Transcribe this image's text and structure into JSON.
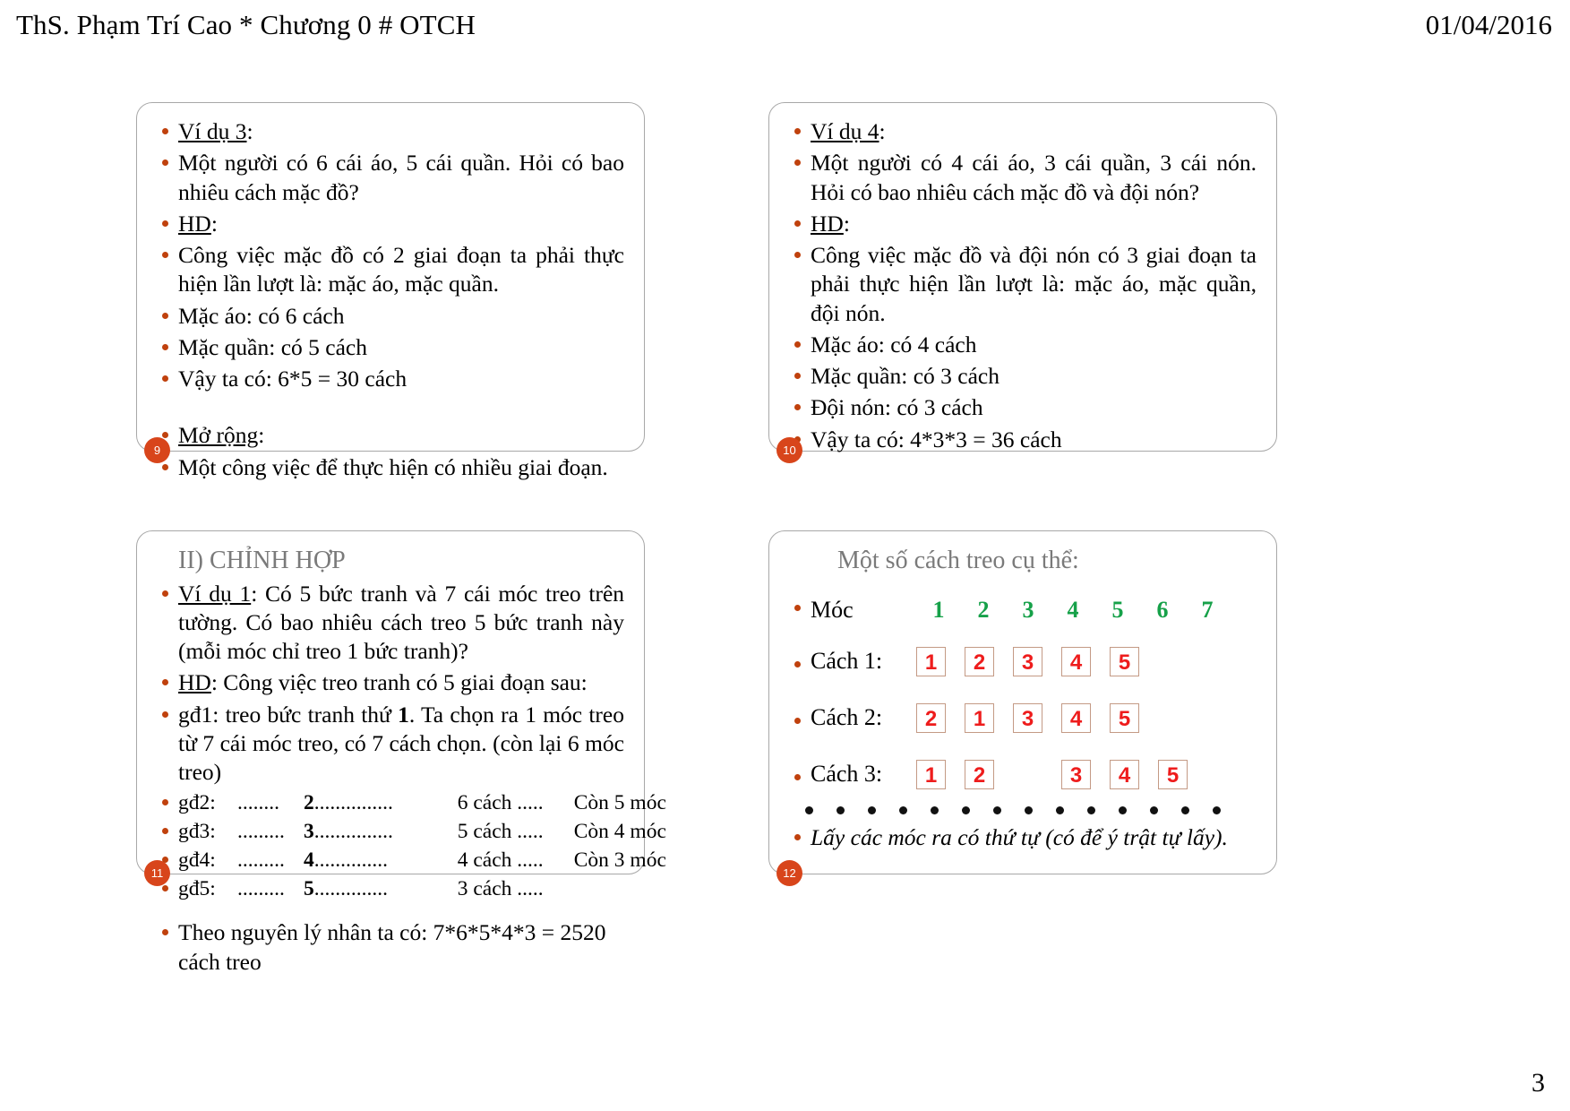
{
  "header": {
    "left": "ThS. Phạm Trí Cao * Chương 0 # OTCH",
    "date": "01/04/2016",
    "page_number": "3"
  },
  "slides": [
    {
      "badge": "9",
      "lines": [
        "Ví dụ 3",
        ":",
        "Một người có 6 cái áo, 5 cái quần. Hỏi có bao nhiêu cách mặc đồ?",
        "HD",
        "Công việc mặc đồ có 2 giai đoạn ta phải thực hiện lần lượt là: mặc áo, mặc quần.",
        "Mặc áo: có 6 cách",
        "Mặc quần: có 5 cách",
        "Vậy ta có: 6*5 = 30 cách",
        "Mở rộng",
        "Một công việc để thực hiện có nhiều giai đoạn."
      ]
    },
    {
      "badge": "10",
      "lines": [
        "Ví dụ 4",
        "Một người có 4 cái áo, 3 cái quần, 3 cái nón. Hỏi có bao nhiêu cách mặc đồ và đội nón?",
        "HD",
        "Công việc mặc đồ và đội nón có 3 giai đoạn ta phải thực hiện lần lượt là: mặc áo, mặc quần, đội nón.",
        "Mặc áo: có 4 cách",
        "Mặc quần: có 3 cách",
        "Đội nón: có 3 cách",
        "Vậy ta có: 4*3*3 = 36 cách"
      ]
    },
    {
      "badge": "11",
      "title": "II) CHỈNH HỢP",
      "vidu_label": "Ví dụ 1",
      "vidu_text": ": Có 5 bức tranh và 7 cái móc treo trên tường. Có bao nhiêu cách treo 5 bức tranh này (mỗi móc chỉ treo 1 bức tranh)?",
      "hd_label": "HD",
      "hd_text": ": Công việc treo tranh có 5 giai đoạn sau:",
      "gd1_pre": "gđ1: treo bức tranh thứ ",
      "gd1_bold": "1",
      "gd1_post": ". Ta chọn ra 1 móc treo từ 7 cái móc treo, có 7 cách chọn. (còn lại 6 móc treo)",
      "gd_rows": [
        {
          "label": "gđ2:",
          "dots1": "........",
          "num": "2",
          "dots2": "...............",
          "ways": "6 cách .....",
          "left": "Còn  5 móc"
        },
        {
          "label": "gđ3:",
          "dots1": ".........",
          "num": "3",
          "dots2": "...............",
          "ways": "5 cách .....",
          "left": "Còn  4 móc"
        },
        {
          "label": "gđ4:",
          "dots1": ".........",
          "num": "4",
          "dots2": "..............",
          "ways": "4 cách .....",
          "left": "Còn  3 móc"
        },
        {
          "label": "gđ5:",
          "dots1": ".........",
          "num": "5",
          "dots2": "..............",
          "ways": "3 cách .....",
          "left": ""
        }
      ],
      "conclusion": "Theo nguyên lý nhân ta có: 7*6*5*4*3 = 2520 cách treo"
    },
    {
      "badge": "12",
      "title": "Một số cách treo cụ thể:",
      "hook_label": "Móc",
      "hooks": [
        "1",
        "2",
        "3",
        "4",
        "5",
        "6",
        "7"
      ],
      "ways": [
        {
          "label": "Cách 1:",
          "cells": [
            "1",
            "2",
            "3",
            "4",
            "5",
            "",
            ""
          ]
        },
        {
          "label": "Cách 2:",
          "cells": [
            "2",
            "1",
            "3",
            "4",
            "5",
            "",
            ""
          ]
        },
        {
          "label": "Cách 3:",
          "cells": [
            "1",
            "2",
            "",
            "3",
            "4",
            "5",
            ""
          ]
        }
      ],
      "dot_count": 14,
      "footer": "Lấy các móc ra có thứ tự (có để ý trật tự lấy)."
    }
  ],
  "colors": {
    "bullet": "#c0410d",
    "badge": "#d8451b",
    "hook_number": "#16a149",
    "cell_number": "#ee1c1c",
    "cell_border": "#c49a85",
    "title_gray": "#7a7a7a",
    "slide_border": "#a8a8a8"
  }
}
